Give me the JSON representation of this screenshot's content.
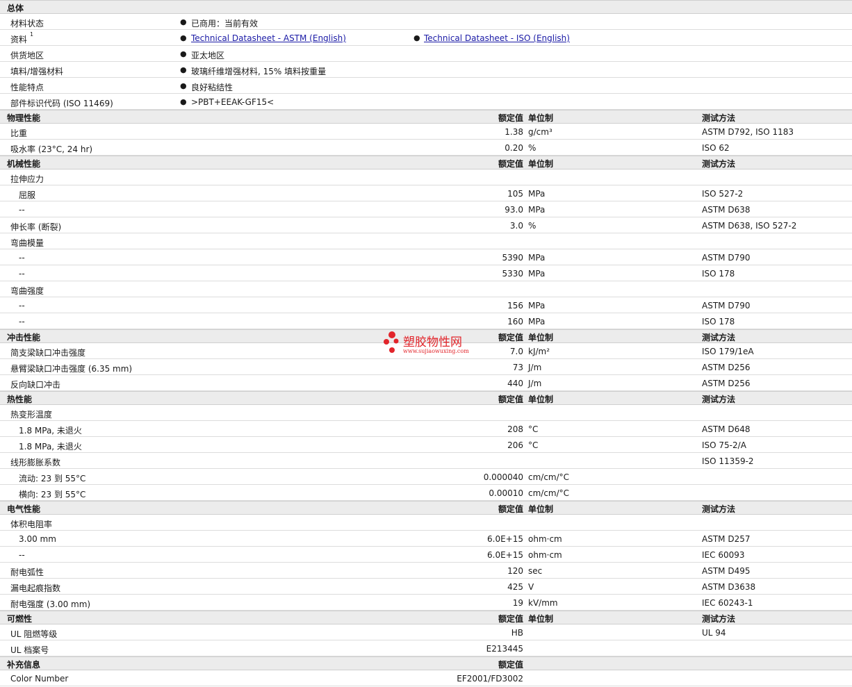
{
  "general": {
    "title": "总体",
    "rows": [
      {
        "label": "材料状态",
        "items": [
          "已商用：当前有效"
        ]
      },
      {
        "label": "资料",
        "sup": "1",
        "links": [
          "Technical Datasheet - ASTM (English)",
          "Technical Datasheet - ISO (English)"
        ]
      },
      {
        "label": "供货地区",
        "items": [
          "亚太地区"
        ]
      },
      {
        "label": "填料/增强材料",
        "items": [
          "玻璃纤维增强材料, 15% 填料按重量"
        ]
      },
      {
        "label": "性能特点",
        "items": [
          "良好粘结性"
        ]
      },
      {
        "label": "部件标识代码  (ISO 11469)",
        "items": [
          ">PBT+EEAK-GF15<"
        ]
      }
    ]
  },
  "headers": {
    "value": "额定值",
    "unit": "单位制",
    "method": "测试方法"
  },
  "sections": [
    {
      "title": "物理性能",
      "rows": [
        {
          "label": "比重",
          "value": "1.38",
          "unit": "g/cm³",
          "method": "ASTM D792, ISO 1183"
        },
        {
          "label": "吸水率  (23°C, 24 hr)",
          "value": "0.20",
          "unit": "%",
          "method": "ISO 62"
        }
      ]
    },
    {
      "title": "机械性能",
      "rows": [
        {
          "label": "拉伸应力"
        },
        {
          "label": "屈服",
          "indent": true,
          "value": "105",
          "unit": "MPa",
          "method": "ISO 527-2"
        },
        {
          "label": "--",
          "indent": true,
          "value": "93.0",
          "unit": "MPa",
          "method": "ASTM D638"
        },
        {
          "label": "伸长率  (断裂)",
          "value": "3.0",
          "unit": "%",
          "method": "ASTM D638, ISO 527-2"
        },
        {
          "label": "弯曲模量"
        },
        {
          "label": "--",
          "indent": true,
          "value": "5390",
          "unit": "MPa",
          "method": "ASTM D790"
        },
        {
          "label": "--",
          "indent": true,
          "value": "5330",
          "unit": "MPa",
          "method": "ISO 178"
        },
        {
          "label": "弯曲强度"
        },
        {
          "label": "--",
          "indent": true,
          "value": "156",
          "unit": "MPa",
          "method": "ASTM D790"
        },
        {
          "label": "--",
          "indent": true,
          "value": "160",
          "unit": "MPa",
          "method": "ISO 178"
        }
      ]
    },
    {
      "title": "冲击性能",
      "rows": [
        {
          "label": "简支梁缺口冲击强度",
          "value": "7.0",
          "unit": "kJ/m²",
          "method": "ISO 179/1eA"
        },
        {
          "label": "悬臂梁缺口冲击强度  (6.35 mm)",
          "value": "73",
          "unit": "J/m",
          "method": "ASTM D256"
        },
        {
          "label": "反向缺口冲击",
          "value": "440",
          "unit": "J/m",
          "method": "ASTM D256"
        }
      ]
    },
    {
      "title": "热性能",
      "rows": [
        {
          "label": "热变形温度"
        },
        {
          "label": "1.8 MPa, 未退火",
          "indent": true,
          "value": "208",
          "unit": "°C",
          "method": "ASTM D648"
        },
        {
          "label": "1.8 MPa, 未退火",
          "indent": true,
          "value": "206",
          "unit": "°C",
          "method": "ISO 75-2/A"
        },
        {
          "label": "线形膨胀系数",
          "method": "ISO 11359-2"
        },
        {
          "label": "流动: 23 到  55°C",
          "indent": true,
          "value": "0.000040",
          "unit": "cm/cm/°C"
        },
        {
          "label": "横向: 23 到  55°C",
          "indent": true,
          "value": "0.00010",
          "unit": "cm/cm/°C"
        }
      ]
    },
    {
      "title": "电气性能",
      "rows": [
        {
          "label": "体积电阻率"
        },
        {
          "label": "3.00 mm",
          "indent": true,
          "value": "6.0E+15",
          "unit": "ohm·cm",
          "method": "ASTM D257"
        },
        {
          "label": "--",
          "indent": true,
          "value": "6.0E+15",
          "unit": "ohm·cm",
          "method": "IEC 60093"
        },
        {
          "label": "耐电弧性",
          "value": "120",
          "unit": "sec",
          "method": "ASTM D495"
        },
        {
          "label": "漏电起痕指数",
          "value": "425",
          "unit": "V",
          "method": "ASTM D3638"
        },
        {
          "label": "耐电强度  (3.00 mm)",
          "value": "19",
          "unit": "kV/mm",
          "method": "IEC 60243-1"
        }
      ]
    },
    {
      "title": "可燃性",
      "rows": [
        {
          "label": "UL 阻燃等级",
          "value": "HB",
          "method": "UL 94"
        },
        {
          "label": "UL 档案号",
          "value": "E213445"
        }
      ]
    },
    {
      "title": "补充信息",
      "value_only": true,
      "rows": [
        {
          "label": "Color Number",
          "value": "EF2001/FD3002"
        }
      ]
    }
  ],
  "watermark": {
    "name": "塑胶物性网",
    "url": "www.sujiaowuxing.com",
    "color": "#e2252b"
  }
}
